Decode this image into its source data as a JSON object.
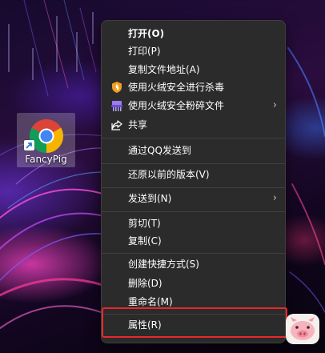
{
  "desktop": {
    "shortcut_label": "FancyPig",
    "shortcut_icon": "chrome-icon"
  },
  "context_menu": {
    "items": [
      {
        "label": "打开(O)",
        "bold": true
      },
      {
        "label": "打印(P)"
      },
      {
        "label": "复制文件地址(A)"
      },
      {
        "label": "使用火绒安全进行杀毒",
        "icon": "huorong-shield-icon"
      },
      {
        "label": "使用火绒安全粉碎文件",
        "icon": "shredder-icon",
        "submenu": true
      },
      {
        "label": "共享",
        "icon": "share-icon"
      },
      {
        "label": "通过QQ发送到"
      },
      {
        "label": "还原以前的版本(V)"
      },
      {
        "label": "发送到(N)",
        "submenu": true
      },
      {
        "label": "剪切(T)"
      },
      {
        "label": "复制(C)"
      },
      {
        "label": "创建快捷方式(S)"
      },
      {
        "label": "删除(D)"
      },
      {
        "label": "重命名(M)"
      },
      {
        "label": "属性(R)"
      }
    ],
    "submenu_glyph": "›"
  },
  "colors": {
    "menu_bg": "#2b2b2b",
    "menu_text": "#ffffff",
    "highlight_border": "#e8282c",
    "shield_orange": "#f0a020"
  },
  "badge_icon": "pig-logo-icon"
}
